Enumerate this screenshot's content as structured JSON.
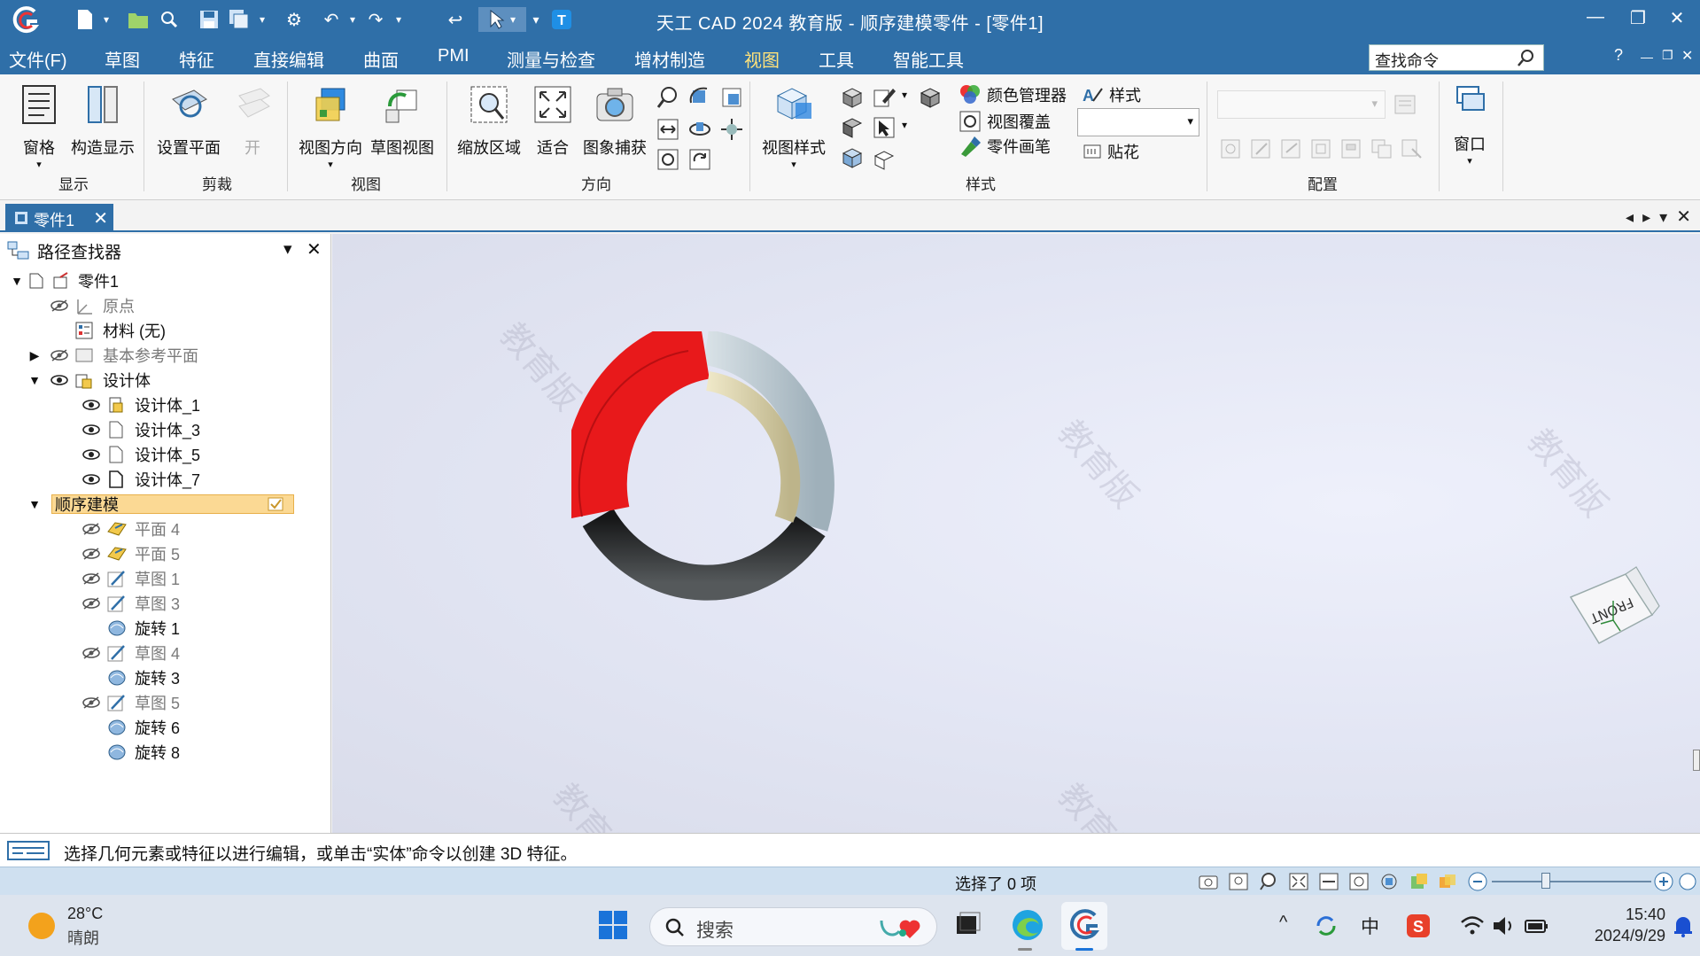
{
  "window": {
    "title": "天工 CAD 2024 教育版 - 顺序建模零件 - [零件1]"
  },
  "menu": {
    "items": [
      "文件(F)",
      "草图",
      "特征",
      "直接编辑",
      "曲面",
      "PMI",
      "测量与检查",
      "增材制造",
      "视图",
      "工具",
      "智能工具"
    ],
    "active": "视图",
    "search_placeholder": "查找命令",
    "help": "?"
  },
  "ribbon": {
    "display": {
      "pane": "窗格",
      "construct": "构造显示",
      "group": "显示"
    },
    "clip": {
      "set_plane": "设置平面",
      "open": "开",
      "group": "剪裁"
    },
    "view": {
      "view_dir": "视图方向",
      "sketch_view": "草图视图",
      "group": "视图"
    },
    "orient": {
      "zoom_area": "缩放区域",
      "fit": "适合",
      "capture": "图象捕获",
      "group": "方向"
    },
    "style": {
      "view_style": "视图样式",
      "color_mgr": "颜色管理器",
      "view_overlay": "视图覆盖",
      "part_painter": "零件画笔",
      "styles": "样式",
      "decal": "贴花",
      "group": "样式"
    },
    "config": {
      "group": "配置"
    },
    "window": {
      "label": "窗口"
    }
  },
  "doc_tab": {
    "label": "零件1"
  },
  "pathfinder": {
    "title": "路径查找器",
    "root": "零件1",
    "origin": "原点",
    "material": "材料 (无)",
    "base_planes": "基本参考平面",
    "design_bodies": "设计体",
    "bodies": [
      "设计体_1",
      "设计体_3",
      "设计体_5",
      "设计体_7"
    ],
    "sequential": "顺序建模",
    "features": [
      "平面 4",
      "平面 5",
      "草图 1",
      "草图 3",
      "旋转 1",
      "草图 4",
      "旋转 3",
      "草图 5",
      "旋转 6",
      "旋转 8"
    ]
  },
  "viewport": {
    "watermark": "教育版",
    "view_cube_label": "FRONT"
  },
  "status": {
    "prompt": "选择几何元素或特征以进行编辑，或单击“实体”命令以创建 3D 特征。",
    "selection": "选择了 0 项"
  },
  "taskbar": {
    "weather_temp": "28°C",
    "weather_desc": "晴朗",
    "search": "搜索",
    "ime": "中",
    "time": "15:40",
    "date": "2024/9/29"
  },
  "colors": {
    "titlebar": "#2f6fa8",
    "accent": "#ffe27a",
    "ring_red": "#e8191b",
    "ring_gray": "#b9c7cf",
    "ring_beige": "#d8d0ac",
    "ring_black": "#2a2d2e"
  }
}
